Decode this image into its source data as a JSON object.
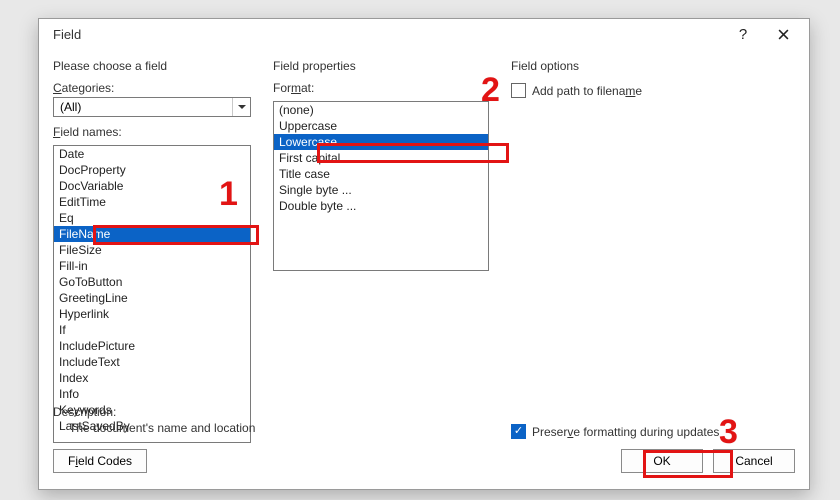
{
  "dialog": {
    "title": "Field"
  },
  "left": {
    "heading": "Please choose a field",
    "categories_label": "Categories:",
    "categories_value": "(All)",
    "field_names_label": "Field names:",
    "items": [
      "Date",
      "DocProperty",
      "DocVariable",
      "EditTime",
      "Eq",
      "FileName",
      "FileSize",
      "Fill-in",
      "GoToButton",
      "GreetingLine",
      "Hyperlink",
      "If",
      "IncludePicture",
      "IncludeText",
      "Index",
      "Info",
      "Keywords",
      "LastSavedBy"
    ],
    "selected_index": 5
  },
  "middle": {
    "heading": "Field properties",
    "format_label": "Format:",
    "items": [
      "(none)",
      "Uppercase",
      "Lowercase",
      "First capital",
      "Title case",
      "Single byte ...",
      "Double byte ..."
    ],
    "selected_index": 2
  },
  "right": {
    "heading": "Field options",
    "add_path_label": "Add path to filename",
    "add_path_checked": false,
    "preserve_label": "Preserve formatting during updates",
    "preserve_checked": true
  },
  "description": {
    "label": "Description:",
    "text": "The document's name and location"
  },
  "buttons": {
    "field_codes": "Field Codes",
    "ok": "OK",
    "cancel": "Cancel"
  },
  "annotations": {
    "n1": "1",
    "n2": "2",
    "n3": "3"
  }
}
